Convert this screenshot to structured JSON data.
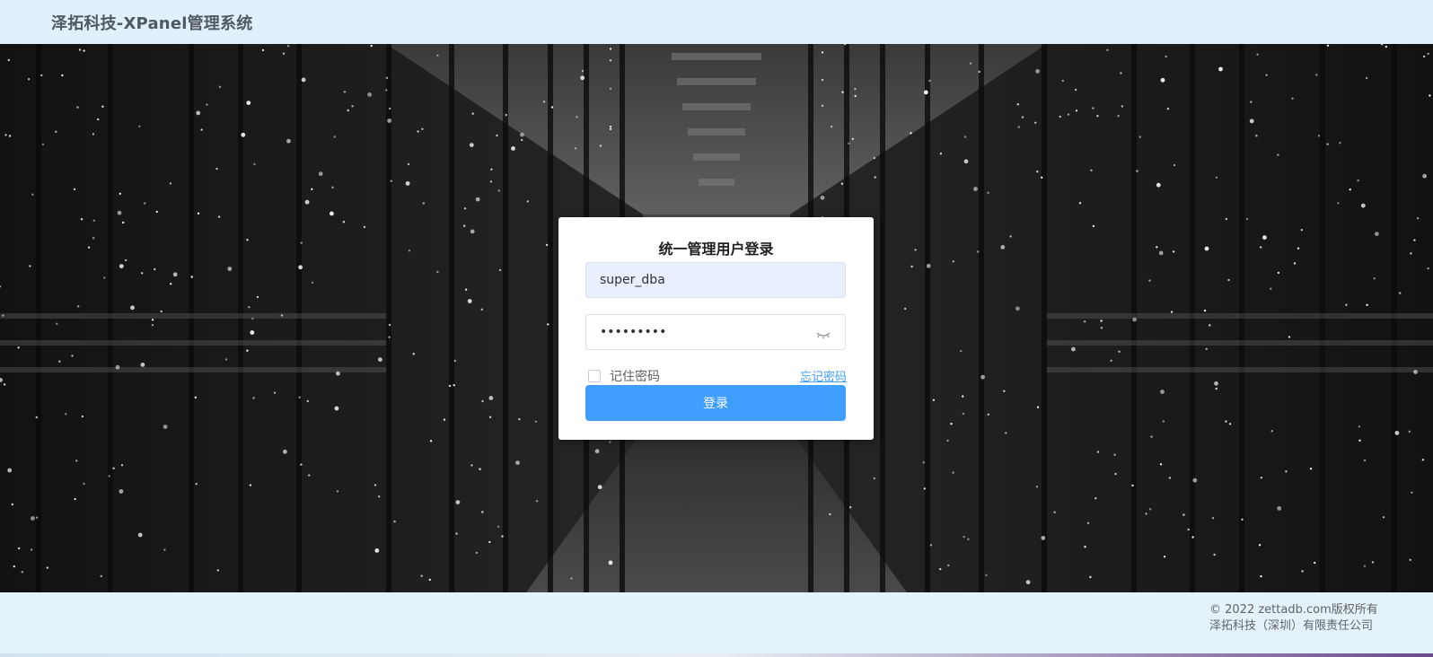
{
  "header": {
    "title": "泽拓科技-XPanel管理系统"
  },
  "login": {
    "title": "统一管理用户登录",
    "username_value": "super_dba",
    "password_masked": "•••••••••",
    "remember_label": "记住密码",
    "forgot_label": "忘记密码",
    "submit_label": "登录"
  },
  "footer": {
    "copyright": "© 2022 zettadb.com版权所有",
    "company": "泽拓科技（深圳）有限责任公司"
  },
  "colors": {
    "header_bg": "#e1f1fb",
    "primary": "#409eff",
    "input_autofill_bg": "#e8f0fe"
  },
  "icons": {
    "password_toggle": "eye-closed-icon"
  }
}
